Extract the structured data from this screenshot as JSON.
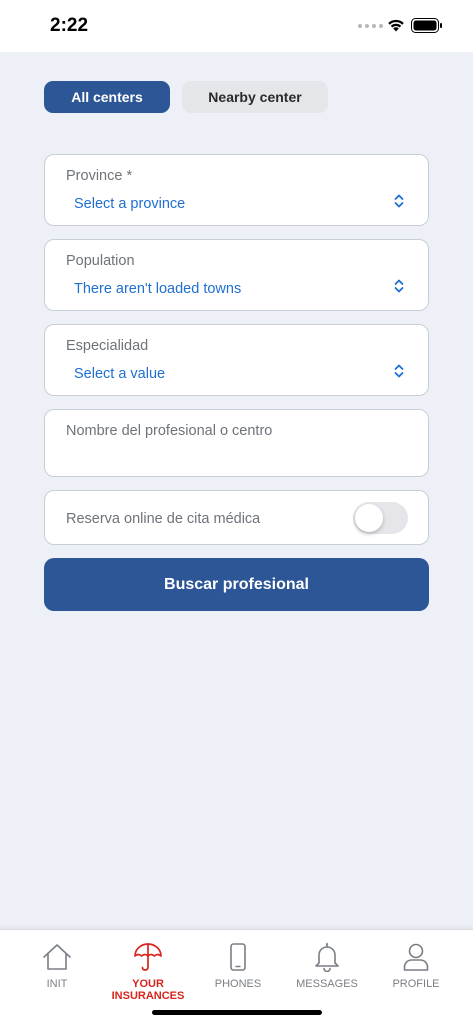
{
  "status_bar": {
    "time": "2:22"
  },
  "segments": {
    "all_centers": "All centers",
    "nearby_center": "Nearby center"
  },
  "form": {
    "province": {
      "label": "Province *",
      "value": "Select a province"
    },
    "population": {
      "label": "Population",
      "value": "There aren't loaded towns"
    },
    "especialidad": {
      "label": "Especialidad",
      "value": "Select a value"
    },
    "nombre": {
      "placeholder": "Nombre del profesional o centro"
    },
    "reserva": {
      "label": "Reserva online de cita médica",
      "enabled": false
    },
    "search_button": "Buscar profesional"
  },
  "tab_bar": {
    "items": [
      {
        "label": "INIT",
        "icon": "home-icon",
        "active": false
      },
      {
        "label": "YOUR INSURANCES",
        "icon": "umbrella-icon",
        "active": true
      },
      {
        "label": "PHONES",
        "icon": "phone-icon",
        "active": false
      },
      {
        "label": "MESSAGES",
        "icon": "bell-icon",
        "active": false
      },
      {
        "label": "PROFILE",
        "icon": "user-icon",
        "active": false
      }
    ]
  },
  "colors": {
    "primary": "#2d5696",
    "accent_red": "#d6261f",
    "link_blue": "#1f6fd1",
    "background": "#edf1f7"
  }
}
